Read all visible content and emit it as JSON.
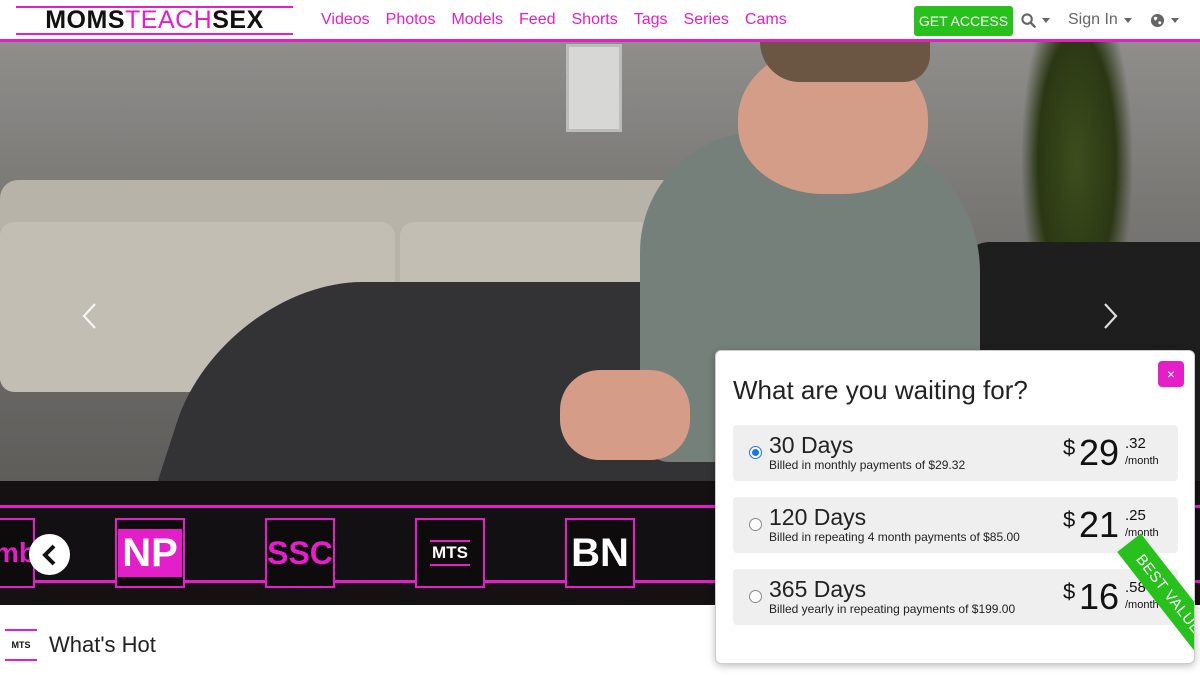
{
  "brand": {
    "part1": "MOMS",
    "part2": "TEACH",
    "part3": "SEX",
    "accent": "#e41ec8",
    "green": "#28c01c"
  },
  "nav": {
    "links": [
      "Videos",
      "Photos",
      "Models",
      "Feed",
      "Shorts",
      "Tags",
      "Series",
      "Cams"
    ],
    "get_access": "GET ACCESS",
    "search_icon": "search-icon",
    "sign_in": "Sign In",
    "globe_icon": "globe-icon"
  },
  "hero": {
    "prev_icon": "chevron-left-icon",
    "next_icon": "chevron-right-icon"
  },
  "strip": {
    "sites": [
      {
        "label": "mb",
        "color": "#e41ec8"
      },
      {
        "label": "NP",
        "color": "#ffffff"
      },
      {
        "label": "SSC",
        "color": "#e41ec8"
      },
      {
        "label": "MTS",
        "color": "#ffffff"
      },
      {
        "label": "BN",
        "color": "#ffffff"
      }
    ],
    "prev_icon": "chevron-left-icon"
  },
  "section": {
    "logo": "MTS",
    "title": "What's Hot"
  },
  "popup": {
    "title": "What are you waiting for?",
    "close": "×",
    "plans": [
      {
        "days": "30 Days",
        "billed": "Billed in monthly payments of $29.32",
        "dollar": "$",
        "amount": "29",
        "cents": ".32",
        "per": "/month",
        "selected": true
      },
      {
        "days": "120 Days",
        "billed": "Billed in repeating 4 month payments of $85.00",
        "dollar": "$",
        "amount": "21",
        "cents": ".25",
        "per": "/month",
        "selected": false
      },
      {
        "days": "365 Days",
        "billed": "Billed yearly in repeating payments of $199.00",
        "dollar": "$",
        "amount": "16",
        "cents": ".58",
        "per": "/month",
        "selected": false
      }
    ],
    "ribbon": "BEST VALUE"
  }
}
